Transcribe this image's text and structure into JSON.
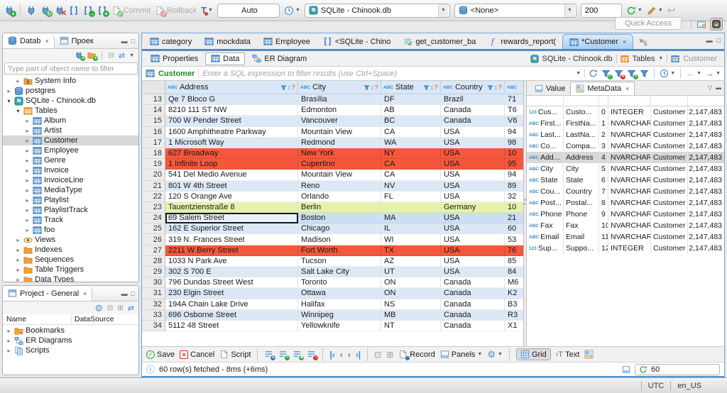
{
  "topbar": {
    "commit": "Commit",
    "rollback": "Rollback",
    "txn_mode": "Auto",
    "connection": "SQLite - Chinook.db",
    "schema": "<None>",
    "fetch_size": "200",
    "quick_access": "Quick Access"
  },
  "sidebar": {
    "tabs": [
      {
        "label": "Datab",
        "icon": "db",
        "active": true
      },
      {
        "label": "Проек",
        "icon": "win"
      }
    ],
    "filter_placeholder": "Type part of object name to filter",
    "tree": [
      {
        "label": "System Info",
        "icon": "folderinfo",
        "indent": 2
      },
      {
        "label": "postgres",
        "icon": "db",
        "indent": 1
      },
      {
        "label": "SQLite - Chinook.db",
        "icon": "dbconn",
        "indent": 1,
        "open": true
      },
      {
        "label": "Tables",
        "icon": "tableo",
        "indent": 2,
        "open": true
      },
      {
        "label": "Album",
        "icon": "table",
        "indent": 3
      },
      {
        "label": "Artist",
        "icon": "table",
        "indent": 3
      },
      {
        "label": "Customer",
        "icon": "table",
        "indent": 3,
        "sel": true
      },
      {
        "label": "Employee",
        "icon": "table",
        "indent": 3
      },
      {
        "label": "Genre",
        "icon": "table",
        "indent": 3
      },
      {
        "label": "Invoice",
        "icon": "table",
        "indent": 3
      },
      {
        "label": "InvoiceLine",
        "icon": "table",
        "indent": 3
      },
      {
        "label": "MediaType",
        "icon": "table",
        "indent": 3
      },
      {
        "label": "Playlist",
        "icon": "table",
        "indent": 3
      },
      {
        "label": "PlaylistTrack",
        "icon": "table",
        "indent": 3
      },
      {
        "label": "Track",
        "icon": "table",
        "indent": 3
      },
      {
        "label": "foo",
        "icon": "table",
        "indent": 3
      },
      {
        "label": "Views",
        "icon": "eye",
        "indent": 2
      },
      {
        "label": "Indexes",
        "icon": "folder",
        "indent": 2
      },
      {
        "label": "Sequences",
        "icon": "folder",
        "indent": 2
      },
      {
        "label": "Table Triggers",
        "icon": "folder",
        "indent": 2
      },
      {
        "label": "Data Types",
        "icon": "folder",
        "indent": 2
      }
    ]
  },
  "project": {
    "title": "Project - General",
    "columns": [
      "Name",
      "DataSource"
    ],
    "items": [
      {
        "label": "Bookmarks",
        "icon": "folderstar"
      },
      {
        "label": "ER Diagrams",
        "icon": "erd"
      },
      {
        "label": "Scripts",
        "icon": "scripts"
      }
    ]
  },
  "editor": {
    "tabs": [
      {
        "label": "category",
        "icon": "table"
      },
      {
        "label": "mockdata",
        "icon": "table"
      },
      {
        "label": "Employee",
        "icon": "table"
      },
      {
        "label": "<SQLite - Chino",
        "icon": "sql"
      },
      {
        "label": "get_customer_ba",
        "icon": "viewq"
      },
      {
        "label": "rewards_report(",
        "icon": "func"
      },
      {
        "label": "*Customer",
        "icon": "table",
        "active": true
      }
    ],
    "overflow_count": "5",
    "subtabs": [
      {
        "label": "Properties",
        "icon": "table"
      },
      {
        "label": "Data",
        "icon": "table",
        "active": true
      },
      {
        "label": "ER Diagram",
        "icon": "erd"
      }
    ],
    "breadcrumb": {
      "connection": "SQLite - Chinook.db",
      "folder": "Tables",
      "table": "Customer"
    }
  },
  "filter": {
    "table": "Customer",
    "placeholder": "Enter a SQL expression to filter results (use Ctrl+Space)"
  },
  "grid": {
    "columns": [
      {
        "label": "Address",
        "w": "c-addr"
      },
      {
        "label": "City",
        "w": "c-city"
      },
      {
        "label": "State",
        "w": "c-state"
      },
      {
        "label": "Country",
        "w": "c-ctry"
      },
      {
        "label": "",
        "w": "c-post"
      }
    ],
    "rows": [
      {
        "n": "13",
        "address": "Qe 7 Bloco G",
        "city": "Brasília",
        "state": "DF",
        "country": "Brazil",
        "postal": "71",
        "hl": ""
      },
      {
        "n": "14",
        "address": "8210 111 ST NW",
        "city": "Edmonton",
        "state": "AB",
        "country": "Canada",
        "postal": "T6",
        "hl": ""
      },
      {
        "n": "15",
        "address": "700 W Pender Street",
        "city": "Vancouver",
        "state": "BC",
        "country": "Canada",
        "postal": "V6",
        "hl": ""
      },
      {
        "n": "16",
        "address": "1600 Amphitheatre Parkway",
        "city": "Mountain View",
        "state": "CA",
        "country": "USA",
        "postal": "94",
        "hl": ""
      },
      {
        "n": "17",
        "address": "1 Microsoft Way",
        "city": "Redmond",
        "state": "WA",
        "country": "USA",
        "postal": "98",
        "hl": ""
      },
      {
        "n": "18",
        "address": "627 Broadway",
        "city": "New York",
        "state": "NY",
        "country": "USA",
        "postal": "10",
        "hl": "red"
      },
      {
        "n": "19",
        "address": "1 Infinite Loop",
        "city": "Cupertino",
        "state": "CA",
        "country": "USA",
        "postal": "95",
        "hl": "red"
      },
      {
        "n": "20",
        "address": "541 Del Medio Avenue",
        "city": "Mountain View",
        "state": "CA",
        "country": "USA",
        "postal": "94",
        "hl": ""
      },
      {
        "n": "21",
        "address": "801 W 4th Street",
        "city": "Reno",
        "state": "NV",
        "country": "USA",
        "postal": "89",
        "hl": ""
      },
      {
        "n": "22",
        "address": "120 S Orange Ave",
        "city": "Orlando",
        "state": "FL",
        "country": "USA",
        "postal": "32",
        "hl": ""
      },
      {
        "n": "23",
        "address": "Tauentzienstraße 8",
        "city": "Berlin",
        "state": "",
        "country": "Germany",
        "postal": "10",
        "hl": "green"
      },
      {
        "n": "24",
        "address": "69 Salem Street",
        "city": "Boston",
        "state": "MA",
        "country": "USA",
        "postal": "21",
        "hl": "sel"
      },
      {
        "n": "25",
        "address": "162 E Superior Street",
        "city": "Chicago",
        "state": "IL",
        "country": "USA",
        "postal": "60",
        "hl": ""
      },
      {
        "n": "26",
        "address": "319 N. Frances Street",
        "city": "Madison",
        "state": "WI",
        "country": "USA",
        "postal": "53",
        "hl": ""
      },
      {
        "n": "27",
        "address": "2211 W Berry Street",
        "city": "Fort Worth",
        "state": "TX",
        "country": "USA",
        "postal": "76",
        "hl": "red"
      },
      {
        "n": "28",
        "address": "1033 N Park Ave",
        "city": "Tucson",
        "state": "AZ",
        "country": "USA",
        "postal": "85",
        "hl": ""
      },
      {
        "n": "29",
        "address": "302 S 700 E",
        "city": "Salt Lake City",
        "state": "UT",
        "country": "USA",
        "postal": "84",
        "hl": ""
      },
      {
        "n": "30",
        "address": "796 Dundas Street West",
        "city": "Toronto",
        "state": "ON",
        "country": "Canada",
        "postal": "M6",
        "hl": ""
      },
      {
        "n": "31",
        "address": "230 Elgin Street",
        "city": "Ottawa",
        "state": "ON",
        "country": "Canada",
        "postal": "K2",
        "hl": ""
      },
      {
        "n": "32",
        "address": "194A Chain Lake Drive",
        "city": "Halifax",
        "state": "NS",
        "country": "Canada",
        "postal": "B3",
        "hl": ""
      },
      {
        "n": "33",
        "address": "696 Osborne Street",
        "city": "Winnipeg",
        "state": "MB",
        "country": "Canada",
        "postal": "R3",
        "hl": ""
      },
      {
        "n": "34",
        "address": "5112 48 Street",
        "city": "Yellowknife",
        "state": "NT",
        "country": "Canada",
        "postal": "X1",
        "hl": ""
      }
    ]
  },
  "panel": {
    "tabs": [
      {
        "label": "Value",
        "icon": "panel"
      },
      {
        "label": "MetaData",
        "icon": "gridc",
        "active": true
      }
    ],
    "columns": [
      "Name",
      "Label",
      "#",
      "Type",
      "Table Name",
      "Max L"
    ],
    "rows": [
      {
        "kind": "123",
        "name": "Cus...",
        "label": "Custo...",
        "num": "0",
        "type": "INTEGER",
        "table": "Customer",
        "max": "2,147,483"
      },
      {
        "kind": "ABC",
        "name": "First...",
        "label": "FirstNa...",
        "num": "1",
        "type": "NVARCHAR",
        "table": "Customer",
        "max": "2,147,483"
      },
      {
        "kind": "ABC",
        "name": "Last...",
        "label": "LastNa...",
        "num": "2",
        "type": "NVARCHAR",
        "table": "Customer",
        "max": "2,147,483"
      },
      {
        "kind": "ABC",
        "name": "Co...",
        "label": "Compa...",
        "num": "3",
        "type": "NVARCHAR",
        "table": "Customer",
        "max": "2,147,483"
      },
      {
        "kind": "ABC",
        "name": "Add...",
        "label": "Address",
        "num": "4",
        "type": "NVARCHAR",
        "table": "Customer",
        "max": "2,147,483",
        "sel": true
      },
      {
        "kind": "ABC",
        "name": "City",
        "label": "City",
        "num": "5",
        "type": "NVARCHAR",
        "table": "Customer",
        "max": "2,147,483"
      },
      {
        "kind": "ABC",
        "name": "State",
        "label": "State",
        "num": "6",
        "type": "NVARCHAR",
        "table": "Customer",
        "max": "2,147,483"
      },
      {
        "kind": "ABC",
        "name": "Cou...",
        "label": "Country",
        "num": "7",
        "type": "NVARCHAR",
        "table": "Customer",
        "max": "2,147,483"
      },
      {
        "kind": "ABC",
        "name": "Post...",
        "label": "Postal...",
        "num": "8",
        "type": "NVARCHAR",
        "table": "Customer",
        "max": "2,147,483"
      },
      {
        "kind": "ABC",
        "name": "Phone",
        "label": "Phone",
        "num": "9",
        "type": "NVARCHAR",
        "table": "Customer",
        "max": "2,147,483"
      },
      {
        "kind": "ABC",
        "name": "Fax",
        "label": "Fax",
        "num": "10",
        "type": "NVARCHAR",
        "table": "Customer",
        "max": "2,147,483"
      },
      {
        "kind": "ABC",
        "name": "Email",
        "label": "Email",
        "num": "11",
        "type": "NVARCHAR",
        "table": "Customer",
        "max": "2,147,483"
      },
      {
        "kind": "123",
        "name": "Sup...",
        "label": "Suppo...",
        "num": "12",
        "type": "INTEGER",
        "table": "Customer",
        "max": "2,147,483"
      }
    ]
  },
  "toolbar2": {
    "save": "Save",
    "cancel": "Cancel",
    "script": "Script",
    "record": "Record",
    "panels": "Panels",
    "grid": "Grid",
    "text": "Text"
  },
  "status": {
    "message": "60 row(s) fetched - 8ms (+6ms)",
    "refresh_value": "60"
  },
  "statusbar": {
    "timezone": "UTC",
    "locale": "en_US"
  }
}
